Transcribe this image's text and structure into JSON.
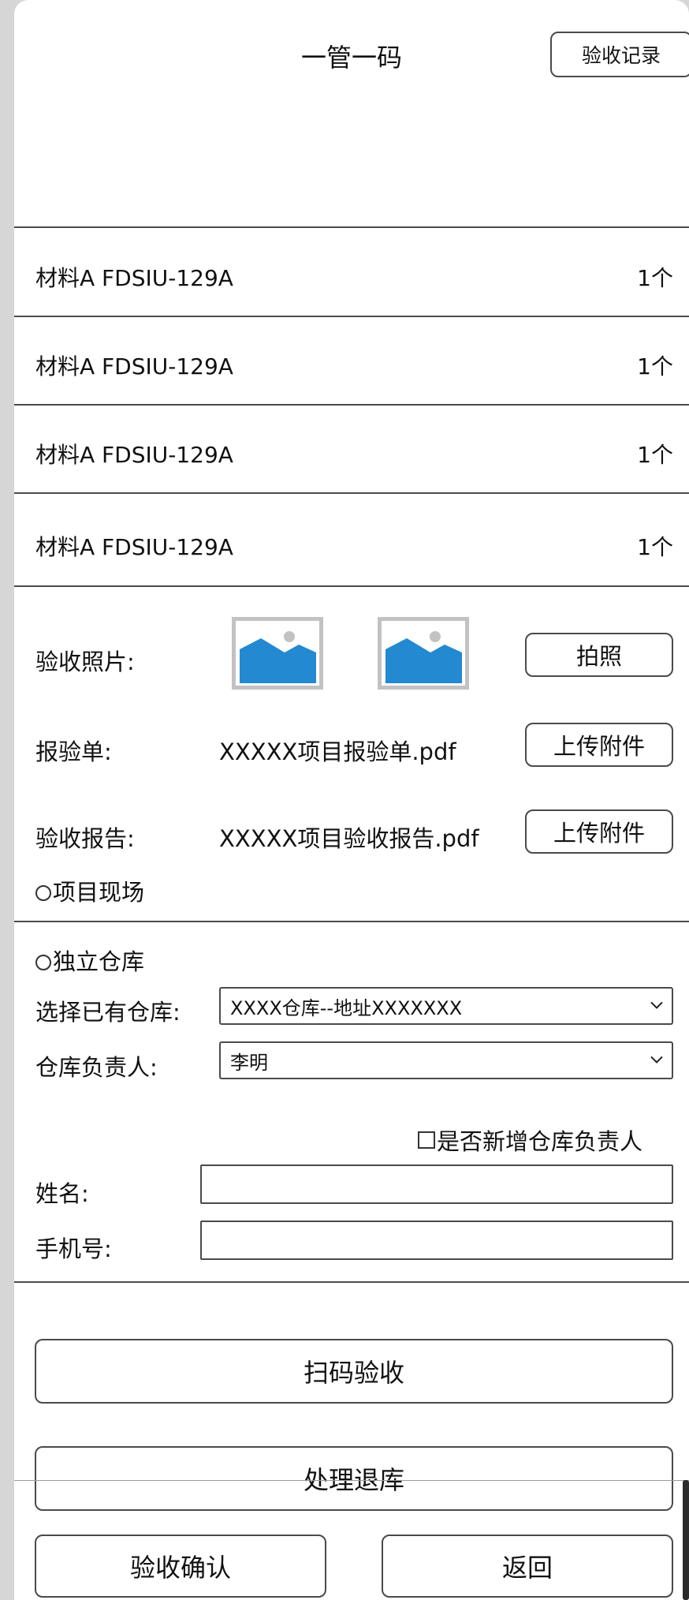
{
  "header": {
    "title": "一管一码",
    "records_button": "验收记录"
  },
  "materials": [
    {
      "name": "材料A FDSIU-129A",
      "qty": "1个"
    },
    {
      "name": "材料A FDSIU-129A",
      "qty": "1个"
    },
    {
      "name": "材料A FDSIU-129A",
      "qty": "1个"
    },
    {
      "name": "材料A FDSIU-129A",
      "qty": "1个"
    }
  ],
  "acceptance": {
    "photo_label": "验收照片:",
    "photo_button": "拍照",
    "inspection_label": "报验单:",
    "inspection_file": "XXXXX项目报验单.pdf",
    "report_label": "验收报告:",
    "report_file": "XXXXX项目验收报告.pdf",
    "upload_button": "上传附件"
  },
  "location": {
    "site_option": "项目现场",
    "warehouse_option": "独立仓库",
    "choose_warehouse_label": "选择已有仓库:",
    "warehouse_value": "XXXX仓库--地址XXXXXXX",
    "manager_label": "仓库负责人:",
    "manager_value": "李明",
    "add_manager_label": "是否新增仓库负责人",
    "name_label": "姓名:",
    "phone_label": "手机号:"
  },
  "actions": {
    "scan": "扫码验收",
    "return_stock": "处理退库",
    "confirm": "验收确认",
    "back": "返回"
  },
  "colors": {
    "image_placeholder_blue": "#2389d0",
    "image_placeholder_border": "#c2c2c2",
    "divider": "#4a4a4a"
  }
}
